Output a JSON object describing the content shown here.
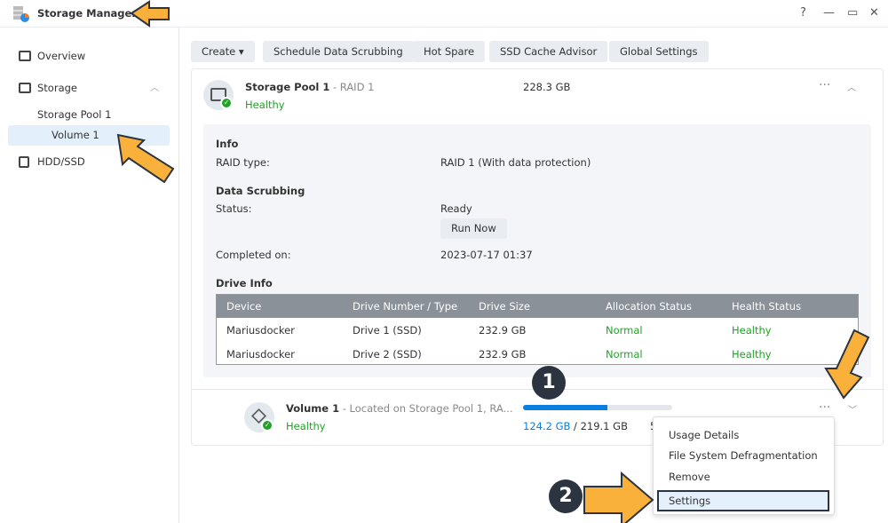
{
  "app": {
    "title": "Storage Manager",
    "controls": [
      "?",
      "—",
      "▭",
      "✕"
    ]
  },
  "sidebar": {
    "items": [
      {
        "label": "Overview"
      },
      {
        "label": "Storage"
      },
      {
        "label": "Storage Pool 1"
      },
      {
        "label": "Volume 1"
      },
      {
        "label": "HDD/SSD"
      }
    ]
  },
  "toolbar": {
    "create": "Create ▾",
    "scrub": "Schedule Data Scrubbing",
    "hotspare": "Hot Spare",
    "ssd": "SSD Cache Advisor",
    "global": "Global Settings"
  },
  "pool": {
    "name": "Storage Pool 1",
    "raid": " - RAID 1",
    "status": "Healthy",
    "size": "228.3 GB",
    "info_title": "Info",
    "raid_label": "RAID type:",
    "raid_value": "RAID 1 (With data protection)",
    "scrub_title": "Data Scrubbing",
    "status_label": "Status:",
    "status_value": "Ready",
    "run_now": "Run Now",
    "completed_label": "Completed on:",
    "completed_value": "2023-07-17 01:37",
    "drive_title": "Drive Info",
    "columns": [
      "Device",
      "Drive Number / Type",
      "Drive Size",
      "Allocation Status",
      "Health Status"
    ],
    "rows": [
      [
        "Mariusdocker",
        "Drive 1 (SSD)",
        "232.9 GB",
        "Normal",
        "Healthy"
      ],
      [
        "Mariusdocker",
        "Drive 2 (SSD)",
        "232.9 GB",
        "Normal",
        "Healthy"
      ]
    ]
  },
  "volume": {
    "name": "Volume 1",
    "location": " - Located on Storage Pool 1, RA...",
    "status": "Healthy",
    "used": "124.2 GB",
    "total": " / 219.1 GB",
    "usage_fraction": 0.567,
    "extra": "5"
  },
  "menu": {
    "items": [
      "Usage Details",
      "File System Defragmentation",
      "Remove",
      "Settings"
    ]
  },
  "annotations": {
    "step1": "1",
    "step2": "2"
  },
  "colors": {
    "accent": "#0a7fe0",
    "healthy": "#23a128",
    "arrow": "#f9b13c",
    "badge": "#2b3440"
  }
}
